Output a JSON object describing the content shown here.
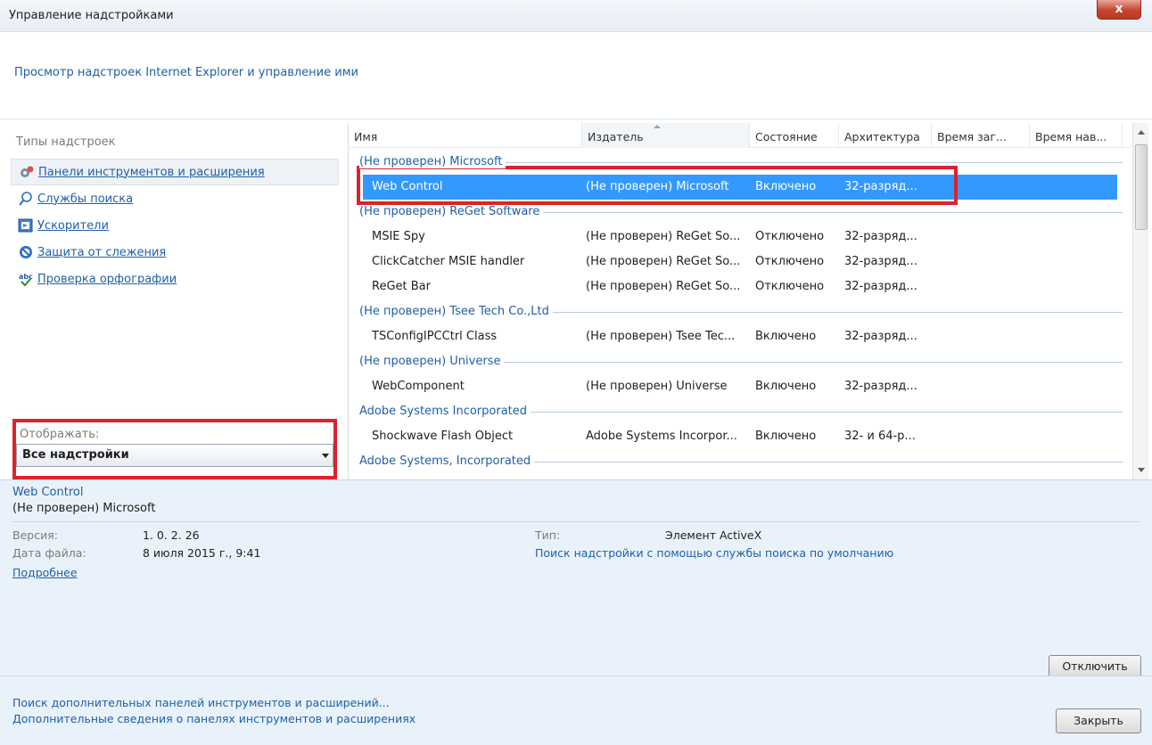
{
  "window": {
    "title": "Управление надстройками",
    "close_label": "x"
  },
  "header": {
    "subtitle": "Просмотр надстроек Internet Explorer и управление ими"
  },
  "sidebar": {
    "heading": "Типы надстроек",
    "items": [
      {
        "label": "Панели инструментов и расширения",
        "icon": "gear-icon"
      },
      {
        "label": "Службы поиска",
        "icon": "search-icon"
      },
      {
        "label": "Ускорители",
        "icon": "accelerator-icon"
      },
      {
        "label": "Защита от слежения",
        "icon": "block-icon"
      },
      {
        "label": "Проверка орфографии",
        "icon": "spellcheck-icon"
      }
    ],
    "show_label": "Отображать:",
    "show_value": "Все надстройки"
  },
  "list": {
    "columns": [
      "Имя",
      "Издатель",
      "Состояние",
      "Архитектура",
      "Время заг...",
      "Время нав..."
    ],
    "groups": [
      {
        "name": "(Не проверен) Microsoft",
        "rows": [
          {
            "name": "Web Control",
            "publisher": "(Не проверен) Microsoft",
            "status": "Включено",
            "arch": "32-разряд...",
            "selected": true
          }
        ]
      },
      {
        "name": "(Не проверен) ReGet Software",
        "rows": [
          {
            "name": "MSIE Spy",
            "publisher": "(Не проверен) ReGet So...",
            "status": "Отключено",
            "arch": "32-разряд..."
          },
          {
            "name": "ClickCatcher MSIE handler",
            "publisher": "(Не проверен) ReGet So...",
            "status": "Отключено",
            "arch": "32-разряд..."
          },
          {
            "name": "ReGet Bar",
            "publisher": "(Не проверен) ReGet So...",
            "status": "Отключено",
            "arch": "32-разряд..."
          }
        ]
      },
      {
        "name": "(Не проверен) Tsee Tech Co.,Ltd",
        "rows": [
          {
            "name": "TSConfigIPCCtrl Class",
            "publisher": "(Не проверен) Tsee Tec...",
            "status": "Включено",
            "arch": "32-разряд..."
          }
        ]
      },
      {
        "name": "(Не проверен) Universe",
        "rows": [
          {
            "name": "WebComponent",
            "publisher": "(Не проверен) Universe",
            "status": "Включено",
            "arch": "32-разряд..."
          }
        ]
      },
      {
        "name": "Adobe Systems Incorporated",
        "rows": [
          {
            "name": "Shockwave Flash Object",
            "publisher": "Adobe Systems Incorpor...",
            "status": "Включено",
            "arch": "32- и 64-р..."
          }
        ]
      },
      {
        "name": "Adobe Systems, Incorporated",
        "rows": []
      }
    ]
  },
  "details": {
    "name": "Web Control",
    "publisher": "(Не проверен) Microsoft",
    "version_label": "Версия:",
    "version_value": "1. 0. 2. 26",
    "date_label": "Дата файла:",
    "date_value": "8 июля 2015 г., 9:41",
    "more_link": "Подробнее",
    "type_label": "Тип:",
    "type_value": "Элемент ActiveX",
    "search_link": "Поиск надстройки с помощью службы поиска по умолчанию",
    "disable_button": "Отключить"
  },
  "footer": {
    "link1": "Поиск дополнительных панелей инструментов и расширений...",
    "link2": "Дополнительные сведения о панелях инструментов и расширениях",
    "close_button": "Закрыть"
  }
}
